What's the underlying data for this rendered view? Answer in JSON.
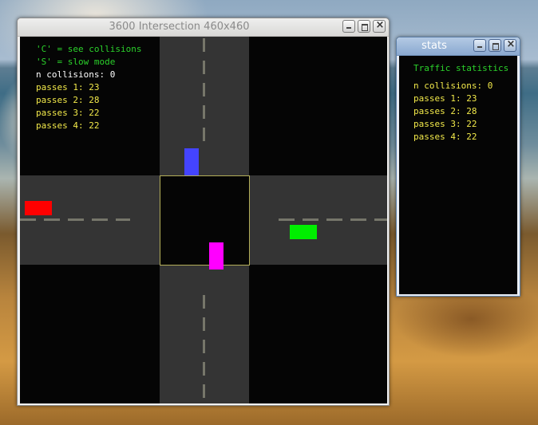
{
  "main_window": {
    "title": "3600 Intersection 460x460",
    "help": [
      "'C' = see collisions",
      "'S' = slow mode"
    ],
    "stats": [
      "n collisions: 0",
      "passes 1: 23",
      "passes 2: 28",
      "passes 3: 22",
      "passes 4: 22"
    ]
  },
  "stats_window": {
    "title": "stats",
    "heading": "Traffic statistics",
    "stats": [
      "n collisions: 0",
      "passes 1: 23",
      "passes 2: 28",
      "passes 3: 22",
      "passes 4: 22"
    ]
  },
  "colors": {
    "road": "#343434",
    "lane_dash": "#76766a",
    "box_border": "#b2ad58",
    "help_text": "#2bd12b",
    "stats_text": "#f2e94a",
    "car_north": "#4444ff",
    "car_west": "#ff0000",
    "car_east": "#00ee00",
    "car_south": "#ff00ff"
  }
}
